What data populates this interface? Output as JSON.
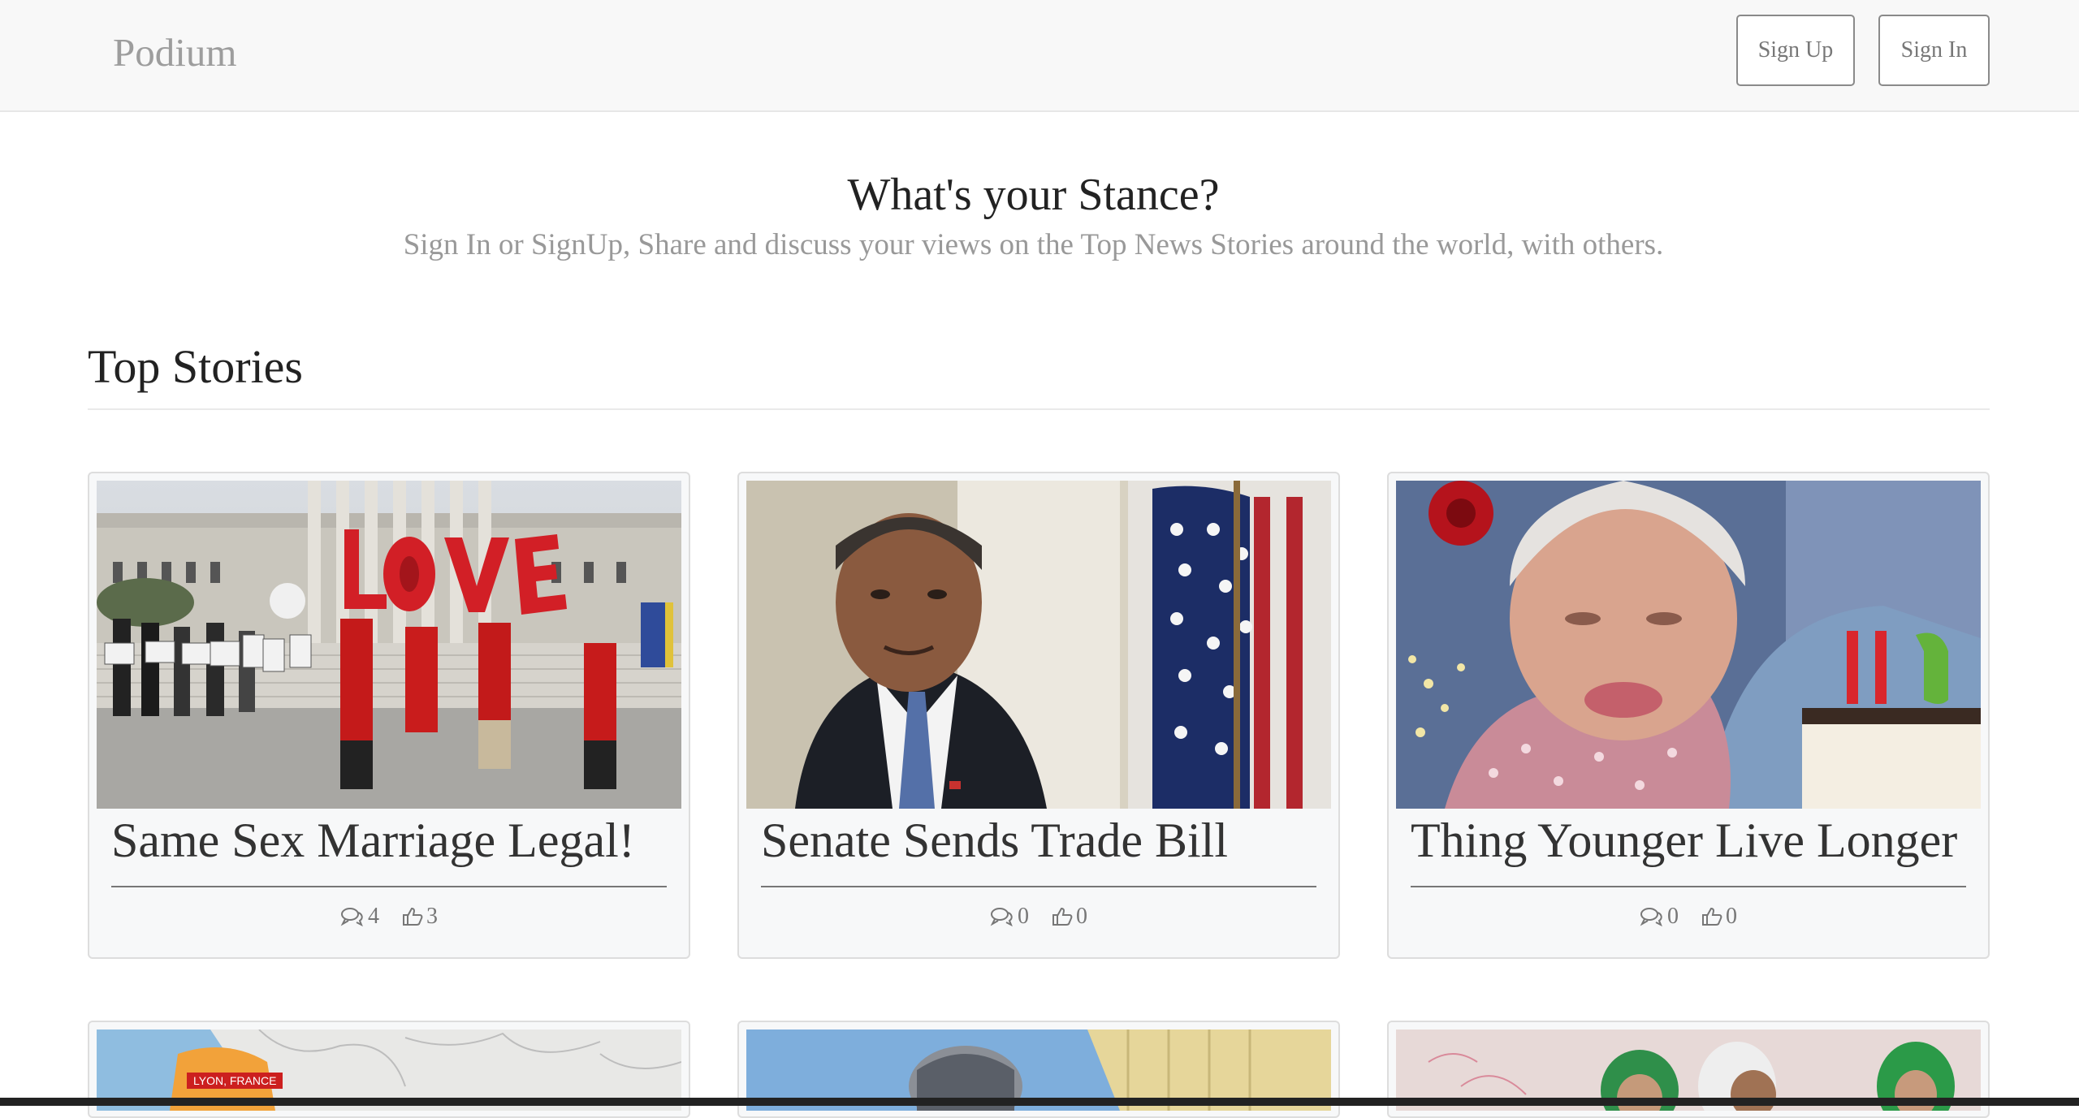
{
  "navbar": {
    "brand": "Podium",
    "signup_label": "Sign Up",
    "signin_label": "Sign In"
  },
  "hero": {
    "title": "What's your Stance?",
    "subtitle": "Sign In or SignUp, Share and discuss your views on the Top News Stories around the world, with others."
  },
  "section": {
    "title": "Top Stories"
  },
  "stories": [
    {
      "title": "Same Sex Marriage Legal!",
      "comments": "4",
      "likes": "3"
    },
    {
      "title": "Senate Sends Trade Bill",
      "comments": "0",
      "likes": "0"
    },
    {
      "title": "Thing Younger Live Longer",
      "comments": "0",
      "likes": "0"
    }
  ],
  "next_row": {
    "map_label": "LYON, FRANCE"
  },
  "colors": {
    "navbar_bg": "#f8f8f8",
    "brand": "#9d9d9d",
    "card_bg": "#f7f8f9",
    "map_tag": "#cc1f1f"
  }
}
